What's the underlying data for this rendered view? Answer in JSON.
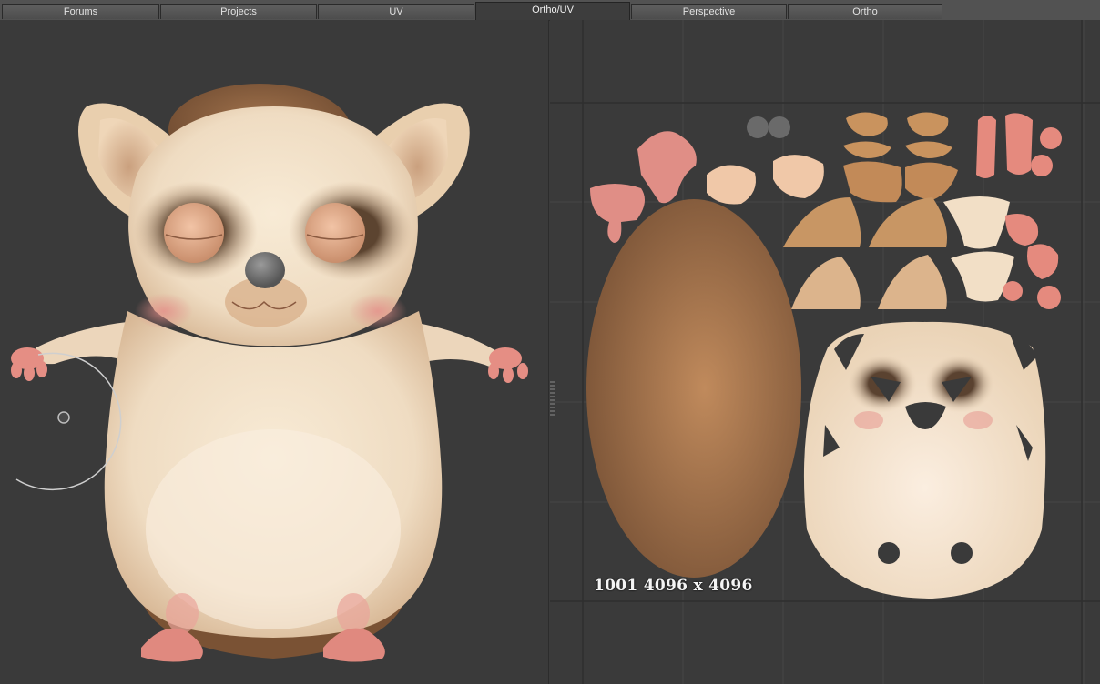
{
  "tabs": [
    {
      "label": "Forums",
      "active": false
    },
    {
      "label": "Projects",
      "active": false
    },
    {
      "label": "UV",
      "active": false
    },
    {
      "label": "Ortho/UV",
      "active": true
    },
    {
      "label": "Perspective",
      "active": false
    },
    {
      "label": "Ortho",
      "active": false
    }
  ],
  "uv_viewport": {
    "tile_label": "1001 4096 x 4096"
  },
  "colors": {
    "background": "#3a3a3a",
    "fur_cream": "#efd9be",
    "fur_brown": "#8a6040",
    "skin_pink": "#e08e86",
    "eye_mask": "#6b5038"
  }
}
